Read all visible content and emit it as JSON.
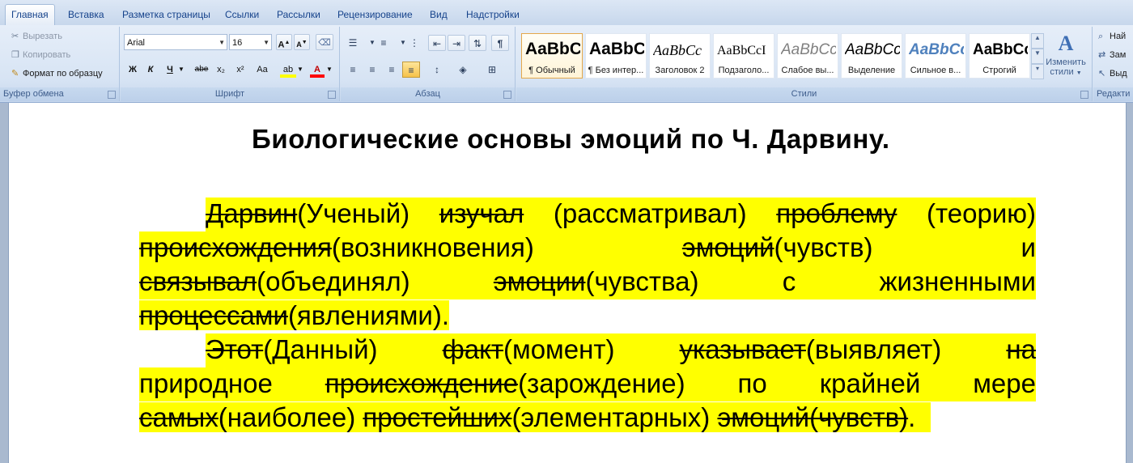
{
  "tabs": [
    "Главная",
    "Вставка",
    "Разметка страницы",
    "Ссылки",
    "Рассылки",
    "Рецензирование",
    "Вид",
    "Надстройки"
  ],
  "clipboard": {
    "cut": "Вырезать",
    "copy": "Копировать",
    "format_painter": "Формат по образцу",
    "label": "Буфер обмена"
  },
  "font": {
    "name": "Arial",
    "size": "16",
    "label": "Шрифт",
    "grow": "A",
    "shrink": "A",
    "bold": "Ж",
    "italic": "К",
    "underline": "Ч",
    "strike": "abe",
    "subscript": "x₂",
    "superscript": "x²",
    "case": "Aa",
    "highlight": "ab",
    "color": "A"
  },
  "paragraph": {
    "label": "Абзац",
    "pilcrow": "¶"
  },
  "styles": {
    "label": "Стили",
    "tiles": [
      {
        "sample": "AaBbC",
        "name": "¶ Обычный"
      },
      {
        "sample": "AaBbC",
        "name": "¶ Без интер..."
      },
      {
        "sample": "AaBbCc",
        "name": "Заголовок 2"
      },
      {
        "sample": "AaBbCcI",
        "name": "Подзаголо..."
      },
      {
        "sample": "AaBbCc",
        "name": "Слабое вы..."
      },
      {
        "sample": "AaBbCc",
        "name": "Выделение"
      },
      {
        "sample": "AaBbCc",
        "name": "Сильное в..."
      },
      {
        "sample": "AaBbCc",
        "name": "Строгий"
      }
    ],
    "change_line1": "Изменить",
    "change_line2": "стили"
  },
  "editing": {
    "label": "Редакти",
    "find": "Най",
    "replace": "Зам",
    "select": "Выд"
  },
  "colors": {
    "highlight": "#ffff00",
    "ribbon_text": "#15428b"
  },
  "document": {
    "title": "Биологические основы эмоций по Ч. Дарвину.",
    "p1": {
      "l1": [
        "Дарвин",
        "(Ученый)",
        "изучал",
        "(рассматривал)",
        "проблему",
        "(теорию)"
      ],
      "l2": [
        "происхождения",
        "(возникновения)",
        "эмоций",
        "(чувств)",
        "и"
      ],
      "l3": [
        "связывал",
        "(объединял)",
        "эмоции",
        "(чувства)",
        "с",
        "жизненными"
      ],
      "l4": [
        "процессами",
        "(явлениями)."
      ]
    },
    "p2": {
      "l1": [
        "Этот",
        "(Данный)",
        "факт",
        "(момент)",
        "указывает",
        "(выявляет)",
        "на"
      ],
      "l2": [
        "природное",
        "происхождение",
        "(зарождение)",
        "по",
        "крайней",
        "мере"
      ],
      "l3": [
        "самых",
        "(наиболее)",
        "простейших",
        "(элементарных)",
        "эмоций(чувств)",
        "."
      ]
    }
  }
}
